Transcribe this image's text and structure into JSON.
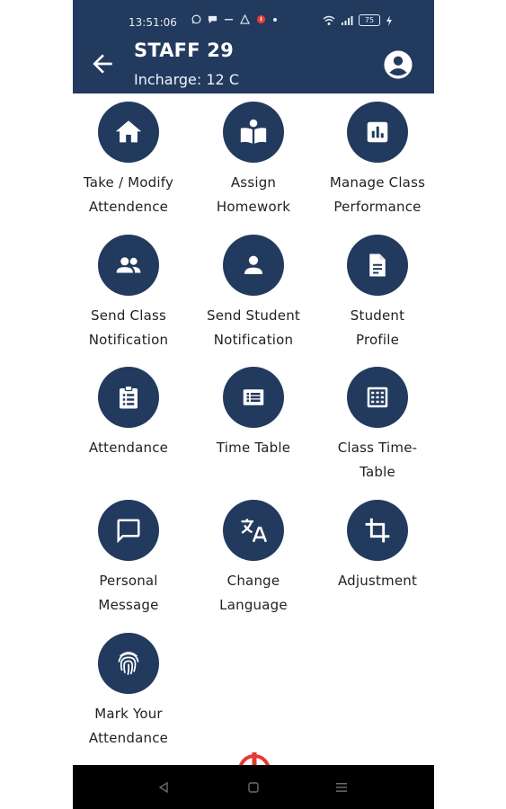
{
  "status_bar": {
    "time": "13:51:06",
    "battery": "75"
  },
  "header": {
    "title": "STAFF 29",
    "subtitle": "Incharge: 12 C",
    "back_icon": "arrow-back-icon",
    "profile_icon": "account-circle-icon"
  },
  "tiles": [
    {
      "label_1": "Take / Modify",
      "label_2": "Attendence",
      "icon": "home-icon"
    },
    {
      "label_1": "Assign",
      "label_2": "Homework",
      "icon": "book-reader-icon"
    },
    {
      "label_1": "Manage Class",
      "label_2": "Performance",
      "icon": "bar-chart-icon"
    },
    {
      "label_1": "Send Class",
      "label_2": "Notification",
      "icon": "group-icon"
    },
    {
      "label_1": "Send Student",
      "label_2": "Notification",
      "icon": "person-icon"
    },
    {
      "label_1": "Student",
      "label_2": "Profile",
      "icon": "document-icon"
    },
    {
      "label_1": "Attendance",
      "label_2": "",
      "icon": "clipboard-icon"
    },
    {
      "label_1": "Time Table",
      "label_2": "",
      "icon": "list-icon"
    },
    {
      "label_1": "Class Time-",
      "label_2": "Table",
      "icon": "calendar-grid-icon"
    },
    {
      "label_1": "Personal",
      "label_2": "Message",
      "icon": "chat-bubble-icon"
    },
    {
      "label_1": "Change",
      "label_2": "Language",
      "icon": "translate-icon"
    },
    {
      "label_1": "Adjustment",
      "label_2": "",
      "icon": "crop-icon"
    },
    {
      "label_1": "Mark Your",
      "label_2": "Attendance",
      "icon": "fingerprint-icon"
    }
  ],
  "colors": {
    "primary": "#223a5e",
    "text": "#222222",
    "nav_bar": "#000000",
    "accent_logo": "#e53935"
  },
  "nav": {
    "back_icon": "nav-back-icon",
    "home_icon": "nav-home-icon",
    "recents_icon": "nav-recents-icon"
  }
}
